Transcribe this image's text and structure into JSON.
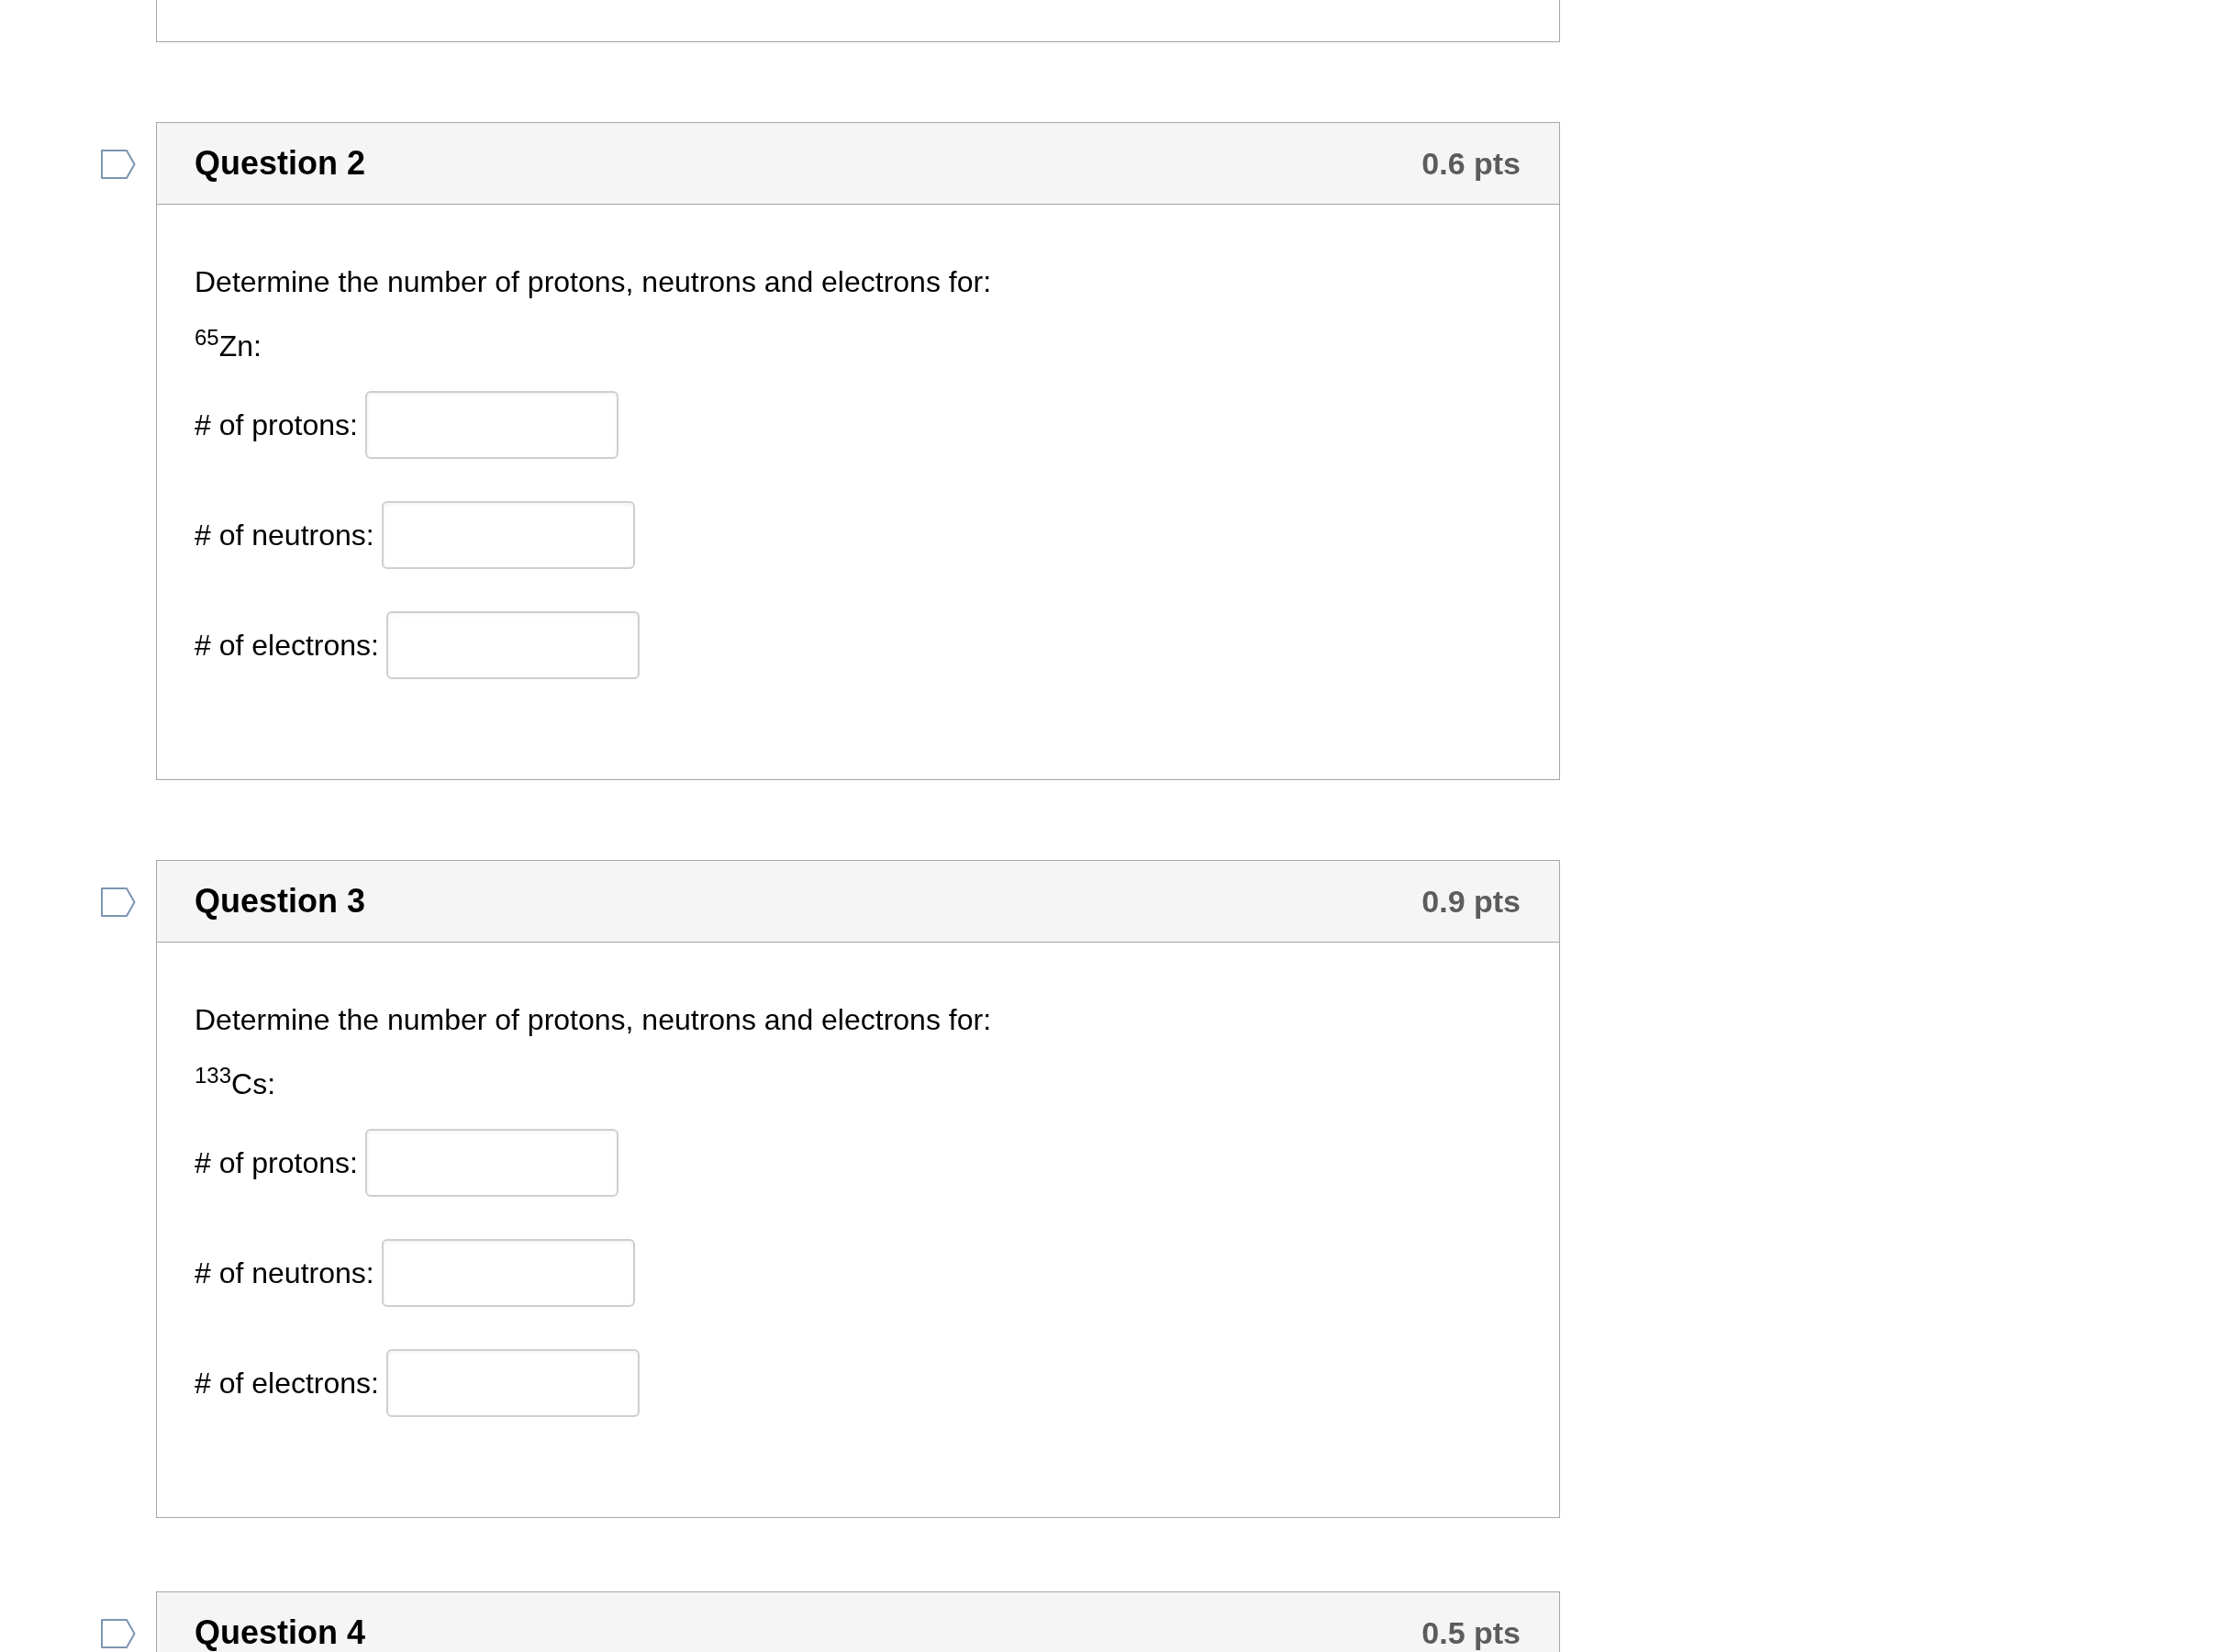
{
  "questions": [
    {
      "title": "Question 2",
      "points": "0.6 pts",
      "flagged": false,
      "prompt": "Determine the number of protons, neutrons and electrons for:",
      "isotope": "$^{65}$Zn:",
      "fields": [
        {
          "label": "# of protons:"
        },
        {
          "label": "# of neutrons:"
        },
        {
          "label": "# of electrons:"
        }
      ]
    },
    {
      "title": "Question 3",
      "points": "0.9 pts",
      "flagged": false,
      "prompt": "Determine the number of protons, neutrons and electrons for:",
      "isotope": "$^{133}$Cs:",
      "fields": [
        {
          "label": "# of protons:"
        },
        {
          "label": "# of neutrons:"
        },
        {
          "label": "# of electrons:"
        }
      ]
    },
    {
      "title": "Question 4",
      "points": "0.5 pts",
      "flagged": false
    }
  ]
}
